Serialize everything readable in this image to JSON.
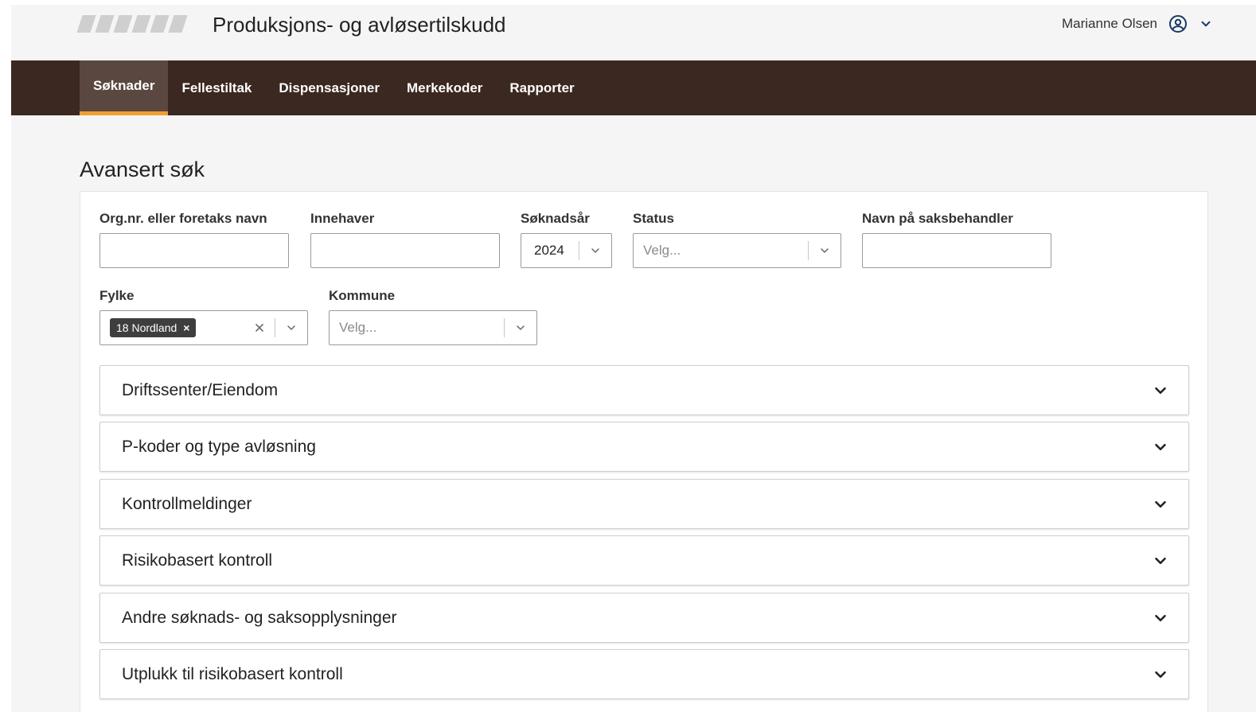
{
  "header": {
    "app_title": "Produksjons- og avløsertilskudd",
    "user_name": "Marianne Olsen"
  },
  "nav": {
    "items": [
      {
        "label": "Søknader",
        "active": true
      },
      {
        "label": "Fellestiltak"
      },
      {
        "label": "Dispensasjoner"
      },
      {
        "label": "Merkekoder"
      },
      {
        "label": "Rapporter"
      }
    ]
  },
  "page": {
    "title": "Avansert søk"
  },
  "form": {
    "org": {
      "label": "Org.nr. eller foretaks navn",
      "value": ""
    },
    "owner": {
      "label": "Innehaver",
      "value": ""
    },
    "year": {
      "label": "Søknadsår",
      "value": "2024"
    },
    "status": {
      "label": "Status",
      "placeholder": "Velg..."
    },
    "handler": {
      "label": "Navn på saksbehandler",
      "value": ""
    },
    "county": {
      "label": "Fylke",
      "selected_tag": "18 Nordland",
      "tag_remove": "×"
    },
    "municipality": {
      "label": "Kommune",
      "placeholder": "Velg..."
    }
  },
  "accordions": [
    {
      "label": "Driftssenter/Eiendom"
    },
    {
      "label": "P-koder og type avløsning"
    },
    {
      "label": "Kontrollmeldinger"
    },
    {
      "label": "Risikobasert kontroll"
    },
    {
      "label": "Andre søknads- og saksopplysninger"
    },
    {
      "label": "Utplukk til risikobasert kontroll"
    }
  ],
  "colors": {
    "nav_bg": "#3b2820",
    "nav_active_bg": "#5a4840",
    "nav_active_accent": "#f0a030",
    "tag_bg": "#3e3e3e"
  },
  "icons": {
    "avatar": "user-circle-icon",
    "user_menu": "chevron-down-icon",
    "dropdown": "chevron-down-icon",
    "clear": "close-icon",
    "accordion": "chevron-down-icon"
  }
}
